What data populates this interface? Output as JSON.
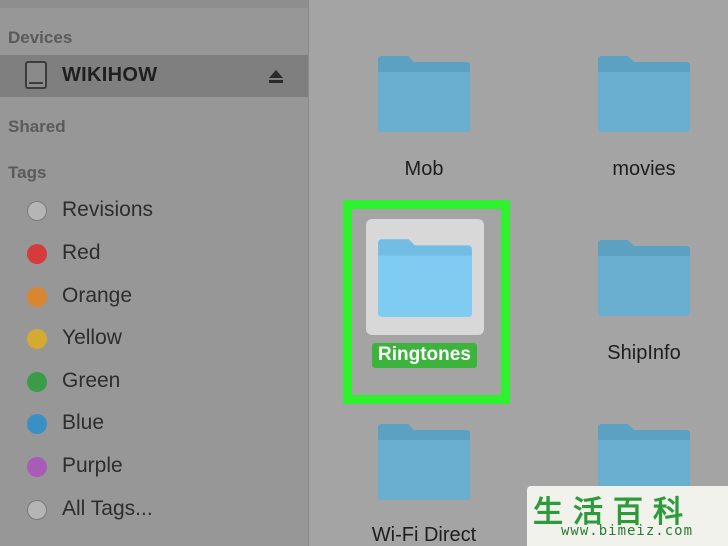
{
  "sidebar": {
    "sections": {
      "devices": "Devices",
      "shared": "Shared",
      "tags": "Tags"
    },
    "device": {
      "label": "WIKIHOW",
      "icon": "external-drive-icon",
      "eject_icon": "eject-icon"
    },
    "tags": [
      {
        "label": "Revisions",
        "color": "#b5b5b5"
      },
      {
        "label": "Red",
        "color": "#d63b3b"
      },
      {
        "label": "Orange",
        "color": "#d98633"
      },
      {
        "label": "Yellow",
        "color": "#d4aa33"
      },
      {
        "label": "Green",
        "color": "#3a9c46"
      },
      {
        "label": "Blue",
        "color": "#3a8fc4"
      },
      {
        "label": "Purple",
        "color": "#a85cb8"
      },
      {
        "label": "All Tags...",
        "color": "#b5b5b5"
      }
    ]
  },
  "main": {
    "folders": [
      {
        "label": "Mob"
      },
      {
        "label": "movies"
      },
      {
        "label": "Ringtones",
        "selected": true
      },
      {
        "label": "ShipInfo"
      },
      {
        "label": "Wi-Fi Direct"
      },
      {
        "label": ""
      }
    ],
    "folder_color": "#6aaed0",
    "selected_folder_color": "#7fcbf2",
    "highlight_color": "#2ef22e"
  },
  "watermark": {
    "text_cn": "生活百科",
    "url": "www.bimeiz.com"
  }
}
